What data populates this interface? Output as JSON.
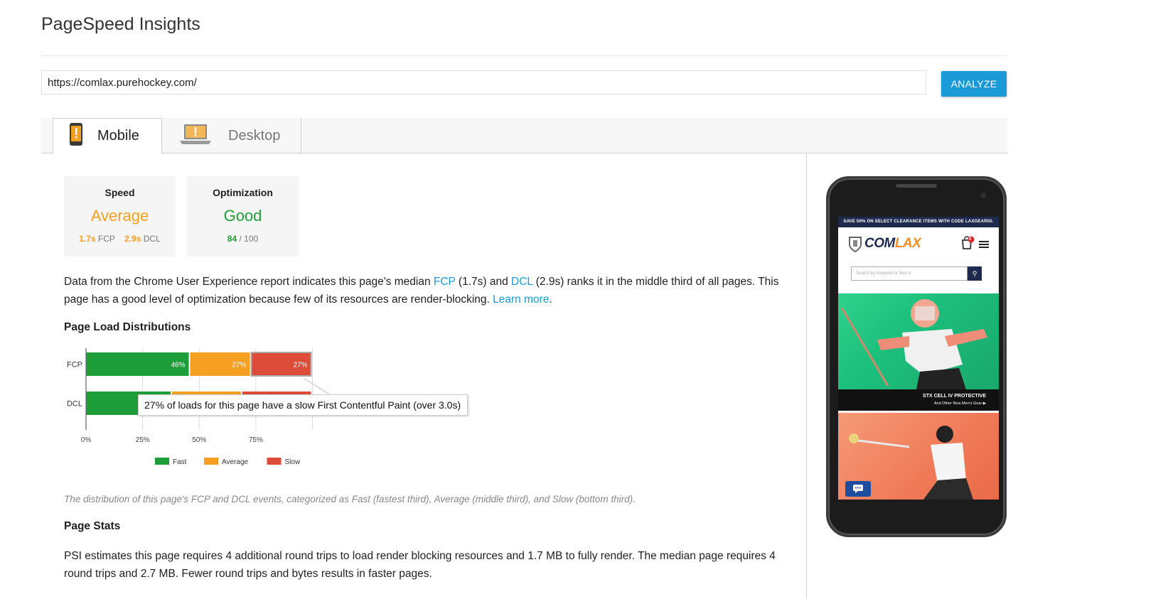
{
  "app": {
    "title": "PageSpeed Insights"
  },
  "url_bar": {
    "value": "https://comlax.purehockey.com/",
    "analyze_label": "ANALYZE"
  },
  "tabs": [
    {
      "label": "Mobile",
      "active": true,
      "icon": "mobile-phone-warning-icon"
    },
    {
      "label": "Desktop",
      "active": false,
      "icon": "laptop-warning-icon"
    }
  ],
  "cards": {
    "speed": {
      "label": "Speed",
      "value": "Average",
      "color": "#f5a023",
      "fcp_value": "1.7s",
      "fcp_label": "FCP",
      "dcl_value": "2.9s",
      "dcl_label": "DCL"
    },
    "optimization": {
      "label": "Optimization",
      "value": "Good",
      "color": "#1e9e3a",
      "score": "84",
      "max": "/ 100"
    }
  },
  "summary": {
    "part1": "Data from the Chrome User Experience report indicates this page's median ",
    "fcp_link": "FCP",
    "part2": " (1.7s) and ",
    "dcl_link": "DCL",
    "part3": " (2.9s) ranks it in the middle third of all pages. This page has a good level of optimization because few of its resources are render-blocking. ",
    "learn_more": "Learn more",
    "part4": "."
  },
  "distributions": {
    "heading": "Page Load Distributions",
    "caption": "The distribution of this page's FCP and DCL events, categorized as Fast (fastest third), Average (middle third), and Slow (bottom third).",
    "tooltip": "27% of loads for this page have a slow First Contentful Paint (over 3.0s)"
  },
  "chart_data": {
    "type": "bar",
    "orientation": "horizontal",
    "stacked": true,
    "categories": [
      "FCP",
      "DCL"
    ],
    "series": [
      {
        "name": "Fast",
        "color": "#1e9e3a",
        "values": [
          46,
          38
        ],
        "labels": [
          "46%",
          ""
        ]
      },
      {
        "name": "Average",
        "color": "#f5a023",
        "values": [
          27,
          31
        ],
        "labels": [
          "27%",
          ""
        ]
      },
      {
        "name": "Slow",
        "color": "#dd4b39",
        "values": [
          27,
          31
        ],
        "labels": [
          "27%",
          ""
        ]
      }
    ],
    "xticks": [
      "0%",
      "25%",
      "50%",
      "75%"
    ],
    "xlim": [
      0,
      100
    ],
    "legend": "bottom",
    "grid": true
  },
  "page_stats": {
    "heading": "Page Stats",
    "text": "PSI estimates this page requires 4 additional round trips to load render blocking resources and 1.7 MB to fully render. The median page requires 4 round trips and 2.7 MB. Fewer round trips and bytes results in faster pages."
  },
  "preview": {
    "promo": "SAVE 50% ON SELECT CLEARANCE ITEMS WITH CODE LAXGEAR50.",
    "logo_a": "COM",
    "logo_b": "LAX",
    "search_placeholder": "Search by Keyword or Item #",
    "cart_count": "0",
    "hero_line1": "STX CELL IV PROTECTIVE",
    "hero_line2": "And Other New Men's Gear ▶"
  }
}
